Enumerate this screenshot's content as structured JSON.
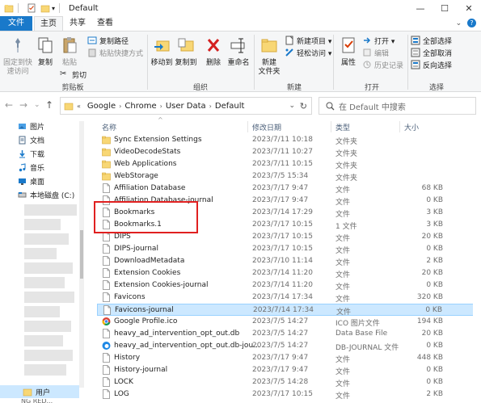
{
  "titlebar": {
    "title": "Default",
    "minimize": "—",
    "maximize": "☐",
    "close": "✕"
  },
  "tabs": {
    "file": "文件",
    "home": "主页",
    "share": "共享",
    "view": "查看",
    "expand": "⌄",
    "help": "?"
  },
  "ribbon": {
    "pin": "固定到快\n速访问",
    "copy": "复制",
    "paste": "粘贴",
    "copy_path": "复制路径",
    "paste_shortcut": "粘贴快捷方式",
    "cut": "剪切",
    "clipboard_group": "剪贴板",
    "move_to": "移动到",
    "copy_to": "复制到",
    "delete": "删除",
    "rename": "重命名",
    "organize_group": "组织",
    "new_folder": "新建\n文件夹",
    "new_item": "新建项目 ▾",
    "easy_access": "轻松访问 ▾",
    "new_group": "新建",
    "properties": "属性",
    "open": "打开 ▾",
    "edit": "编辑",
    "history": "历史记录",
    "open_group": "打开",
    "select_all": "全部选择",
    "select_none": "全部取消",
    "invert_selection": "反向选择",
    "select_group": "选择"
  },
  "nav": {
    "back": "←",
    "forward": "→",
    "dropdown": "⌄",
    "up": "↑",
    "breadcrumb": [
      "«",
      "Google",
      "Chrome",
      "User Data",
      "Default"
    ],
    "address_dropdown": "⌄",
    "refresh": "↻",
    "search_placeholder": "在 Default 中搜索"
  },
  "sidebar": {
    "items": [
      {
        "label": "图片",
        "icon": "pictures-icon"
      },
      {
        "label": "文档",
        "icon": "documents-icon"
      },
      {
        "label": "下载",
        "icon": "downloads-icon"
      },
      {
        "label": "音乐",
        "icon": "music-icon"
      },
      {
        "label": "桌面",
        "icon": "desktop-icon"
      },
      {
        "label": "本地磁盘 (C:)",
        "icon": "drive-icon"
      }
    ],
    "user_label": "用户",
    "bottom_label": "NG RED..."
  },
  "columns": {
    "name": "名称",
    "date": "修改日期",
    "type": "类型",
    "size": "大小",
    "sort_indicator": "^"
  },
  "files": [
    {
      "name": "Sync Extension Settings",
      "date": "2023/7/11 10:18",
      "type": "文件夹",
      "size": "",
      "kind": "folder"
    },
    {
      "name": "VideoDecodeStats",
      "date": "2023/7/11 10:27",
      "type": "文件夹",
      "size": "",
      "kind": "folder"
    },
    {
      "name": "Web Applications",
      "date": "2023/7/11 10:15",
      "type": "文件夹",
      "size": "",
      "kind": "folder"
    },
    {
      "name": "WebStorage",
      "date": "2023/7/5 15:34",
      "type": "文件夹",
      "size": "",
      "kind": "folder"
    },
    {
      "name": "Affiliation Database",
      "date": "2023/7/17 9:47",
      "type": "文件",
      "size": "68 KB",
      "kind": "file"
    },
    {
      "name": "Affiliation Database-journal",
      "date": "2023/7/17 9:47",
      "type": "文件",
      "size": "0 KB",
      "kind": "file"
    },
    {
      "name": "Bookmarks",
      "date": "2023/7/14 17:29",
      "type": "文件",
      "size": "3 KB",
      "kind": "file"
    },
    {
      "name": "Bookmarks.1",
      "date": "2023/7/17 10:15",
      "type": "1 文件",
      "size": "3 KB",
      "kind": "file"
    },
    {
      "name": "DIPS",
      "date": "2023/7/17 10:15",
      "type": "文件",
      "size": "20 KB",
      "kind": "file"
    },
    {
      "name": "DIPS-journal",
      "date": "2023/7/17 10:15",
      "type": "文件",
      "size": "0 KB",
      "kind": "file"
    },
    {
      "name": "DownloadMetadata",
      "date": "2023/7/10 11:14",
      "type": "文件",
      "size": "2 KB",
      "kind": "file"
    },
    {
      "name": "Extension Cookies",
      "date": "2023/7/14 11:20",
      "type": "文件",
      "size": "20 KB",
      "kind": "file"
    },
    {
      "name": "Extension Cookies-journal",
      "date": "2023/7/14 11:20",
      "type": "文件",
      "size": "0 KB",
      "kind": "file"
    },
    {
      "name": "Favicons",
      "date": "2023/7/14 17:34",
      "type": "文件",
      "size": "320 KB",
      "kind": "file"
    },
    {
      "name": "Favicons-journal",
      "date": "2023/7/14 17:34",
      "type": "文件",
      "size": "0 KB",
      "kind": "file",
      "selected": true
    },
    {
      "name": "Google Profile.ico",
      "date": "2023/7/5 14:27",
      "type": "ICO 图片文件",
      "size": "194 KB",
      "kind": "chrome"
    },
    {
      "name": "heavy_ad_intervention_opt_out.db",
      "date": "2023/7/5 14:27",
      "type": "Data Base File",
      "size": "20 KB",
      "kind": "file"
    },
    {
      "name": "heavy_ad_intervention_opt_out.db-jou...",
      "date": "2023/7/5 14:27",
      "type": "DB-JOURNAL 文件",
      "size": "0 KB",
      "kind": "edge"
    },
    {
      "name": "History",
      "date": "2023/7/17 9:47",
      "type": "文件",
      "size": "448 KB",
      "kind": "file"
    },
    {
      "name": "History-journal",
      "date": "2023/7/17 9:47",
      "type": "文件",
      "size": "0 KB",
      "kind": "file"
    },
    {
      "name": "LOCK",
      "date": "2023/7/5 14:28",
      "type": "文件",
      "size": "0 KB",
      "kind": "file"
    },
    {
      "name": "LOG",
      "date": "2023/7/17 10:15",
      "type": "文件",
      "size": "2 KB",
      "kind": "file"
    }
  ]
}
